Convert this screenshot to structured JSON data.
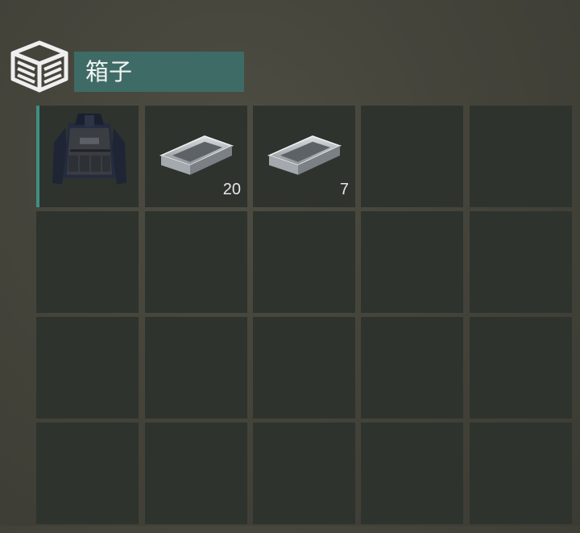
{
  "container": {
    "icon": "box-icon",
    "title": "箱子"
  },
  "grid": {
    "columns": 5,
    "rows": 4,
    "slots": [
      {
        "item": "police-vest",
        "count": "",
        "selected": true
      },
      {
        "item": "metal-ingot",
        "count": "20",
        "selected": false
      },
      {
        "item": "metal-ingot",
        "count": "7",
        "selected": false
      },
      {
        "item": "",
        "count": "",
        "selected": false
      },
      {
        "item": "",
        "count": "",
        "selected": false
      },
      {
        "item": "",
        "count": "",
        "selected": false
      },
      {
        "item": "",
        "count": "",
        "selected": false
      },
      {
        "item": "",
        "count": "",
        "selected": false
      },
      {
        "item": "",
        "count": "",
        "selected": false
      },
      {
        "item": "",
        "count": "",
        "selected": false
      },
      {
        "item": "",
        "count": "",
        "selected": false
      },
      {
        "item": "",
        "count": "",
        "selected": false
      },
      {
        "item": "",
        "count": "",
        "selected": false
      },
      {
        "item": "",
        "count": "",
        "selected": false
      },
      {
        "item": "",
        "count": "",
        "selected": false
      },
      {
        "item": "",
        "count": "",
        "selected": false
      },
      {
        "item": "",
        "count": "",
        "selected": false
      },
      {
        "item": "",
        "count": "",
        "selected": false
      },
      {
        "item": "",
        "count": "",
        "selected": false
      },
      {
        "item": "",
        "count": "",
        "selected": false
      }
    ]
  },
  "colors": {
    "accent": "#3e6b66",
    "slot": "#2e332e",
    "selection": "#3f8f86"
  }
}
